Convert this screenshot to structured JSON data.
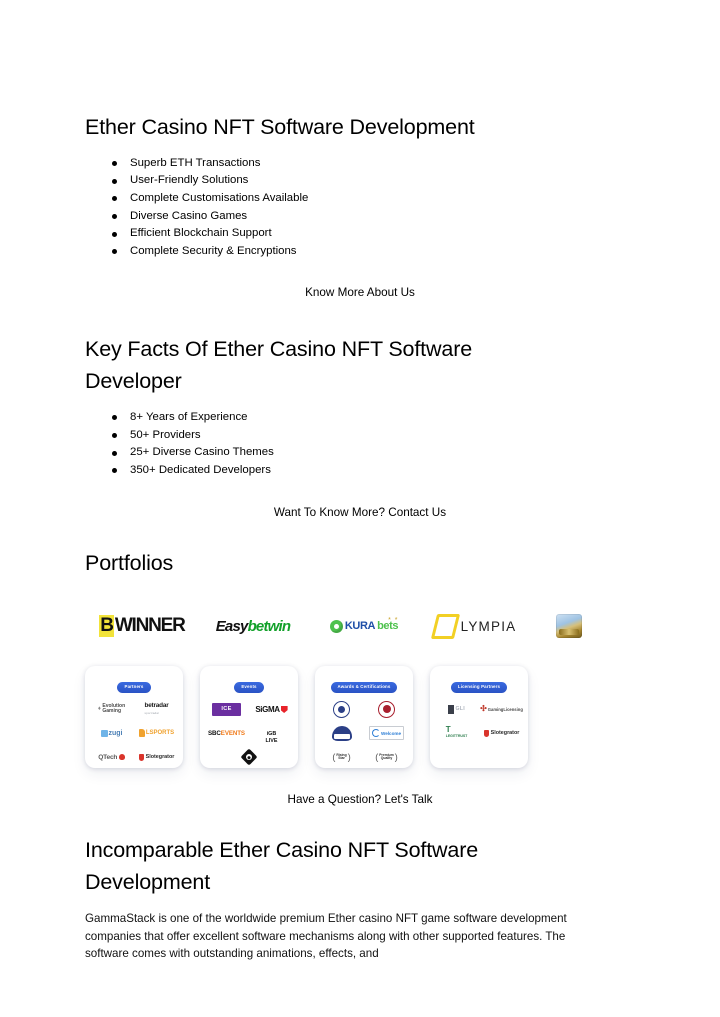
{
  "page": {
    "background": "#ffffff",
    "accent_blue": "#2f5fd6"
  },
  "sections": [
    {
      "id": "ether-casino-nft-software-development",
      "heading": "Ether Casino NFT Software Development",
      "bullets": [
        "Superb ETH Transactions",
        "User-Friendly Solutions",
        "Complete Customisations Available",
        "Diverse Casino Games",
        "Efficient Blockchain Support",
        "Complete Security & Encryptions"
      ],
      "cta": "Know More About Us"
    },
    {
      "id": "key-facts",
      "heading": "Key Facts Of Ether Casino NFT Software Developer",
      "bullets": [
        "8+ Years of Experience",
        "50+ Providers",
        "25+ Diverse Casino Themes",
        "350+ Dedicated Developers"
      ],
      "cta": "Want To Know More? Contact Us"
    },
    {
      "id": "portfolios",
      "heading": "Portfolios",
      "cta": "Have a Question? Let's Talk"
    },
    {
      "id": "incomparable",
      "heading": "Incomparable Ether Casino NFT Software Development",
      "body": "GammaStack is one of the worldwide premium Ether casino NFT game software development companies that offer excellent software mechanisms along with other supported features. The software comes with outstanding animations, effects, and"
    }
  ],
  "portfolio_logos": [
    {
      "name": "BWINNER",
      "part1": "B",
      "part2": "WINNER",
      "color1": "#f2e33a",
      "color2": "#111111"
    },
    {
      "name": "Easybetwin",
      "part1": "Easy",
      "part2": "betwin",
      "color1": "#111111",
      "color2": "#12a12a"
    },
    {
      "name": "KURAbets",
      "part1": "KURA",
      "part2": "bets",
      "color1": "#1f4fa8",
      "color2": "#4ec24e"
    },
    {
      "name": "LYMPIA",
      "part1": "",
      "part2": "LYMPIA",
      "color1": "#f2d024",
      "color2": "#222222"
    },
    {
      "name": "Casino Emblem",
      "part1": "",
      "part2": "",
      "color1": "#a8872f",
      "color2": "#9fc3e3"
    }
  ],
  "cards": [
    {
      "badge": "Partners",
      "logos": [
        "Evolution Gaming",
        "betradar",
        "zugi",
        "LSPORTS",
        "QTech",
        "Slotegrator"
      ]
    },
    {
      "badge": "Events",
      "logos": [
        "ICE",
        "SiGMA",
        "SBC EVENTS",
        "iGB LIVE",
        "Diamond Event"
      ]
    },
    {
      "badge": "Awards & Certifications",
      "logos": [
        "Certification Seal",
        "Award Seal",
        "iTech Labs",
        "Welcome Certificate",
        "Rising Star Award",
        "Premium Quality Award"
      ]
    },
    {
      "badge": "Licensing Partners",
      "logos": [
        "GLI Certification",
        "Gaming Licensing",
        "LegitTRUST",
        "Slotegrator"
      ]
    }
  ]
}
